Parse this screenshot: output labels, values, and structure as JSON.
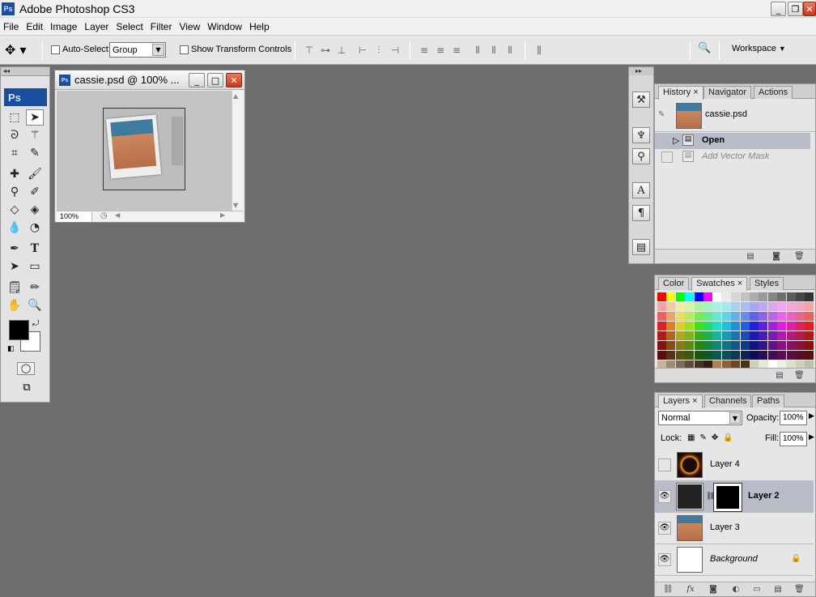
{
  "app": {
    "title": "Adobe Photoshop CS3",
    "logo": "Ps"
  },
  "menu": [
    "File",
    "Edit",
    "Image",
    "Layer",
    "Select",
    "Filter",
    "View",
    "Window",
    "Help"
  ],
  "options": {
    "auto_select_label": "Auto-Select:",
    "auto_select_value": "Group",
    "show_transform_label": "Show Transform Controls",
    "workspace_label": "Workspace"
  },
  "toolbox": {
    "logo": "Ps"
  },
  "document": {
    "title": "cassie.psd @ 100% ...",
    "zoom": "100%"
  },
  "history": {
    "tabs": [
      "History",
      "Navigator",
      "Actions"
    ],
    "snapshot": "cassie.psd",
    "items": [
      "Open",
      "Add Vector Mask"
    ]
  },
  "color_panel": {
    "tabs": [
      "Color",
      "Swatches",
      "Styles"
    ]
  },
  "layers": {
    "tabs": [
      "Layers",
      "Channels",
      "Paths"
    ],
    "blend_mode": "Normal",
    "opacity_label": "Opacity:",
    "opacity": "100%",
    "lock_label": "Lock:",
    "fill_label": "Fill:",
    "fill": "100%",
    "rows": [
      {
        "name": "Layer 4",
        "visible": false
      },
      {
        "name": "Layer 2",
        "visible": true,
        "selected": true
      },
      {
        "name": "Layer 3",
        "visible": true
      },
      {
        "name": "Background",
        "visible": true,
        "locked": true
      }
    ]
  },
  "colors": {
    "accent": "#1a4fa0",
    "selection": "#b8bcc8",
    "workspace_bg": "#6e6e6e"
  }
}
